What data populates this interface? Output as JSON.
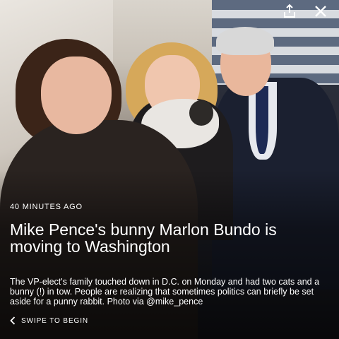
{
  "photo": {
    "description_label": ""
  },
  "top_bar": {
    "share_icon": "share-icon",
    "close_icon": "close-icon"
  },
  "story": {
    "timestamp": "40 MINUTES AGO",
    "headline": "Mike Pence's bunny Marlon Bundo is moving to Washington",
    "summary": "The VP-elect's family touched down in D.C. on Monday and had two cats and a bunny (!) in tow. People are realizing that sometimes politics can briefly be set aside for a punny rabbit. Photo via @mike_pence",
    "swipe_label": "SWIPE TO BEGIN",
    "swipe_icon": "chevron-left-icon"
  },
  "colors": {
    "text": "#ffffff",
    "overlay": "#000000"
  }
}
